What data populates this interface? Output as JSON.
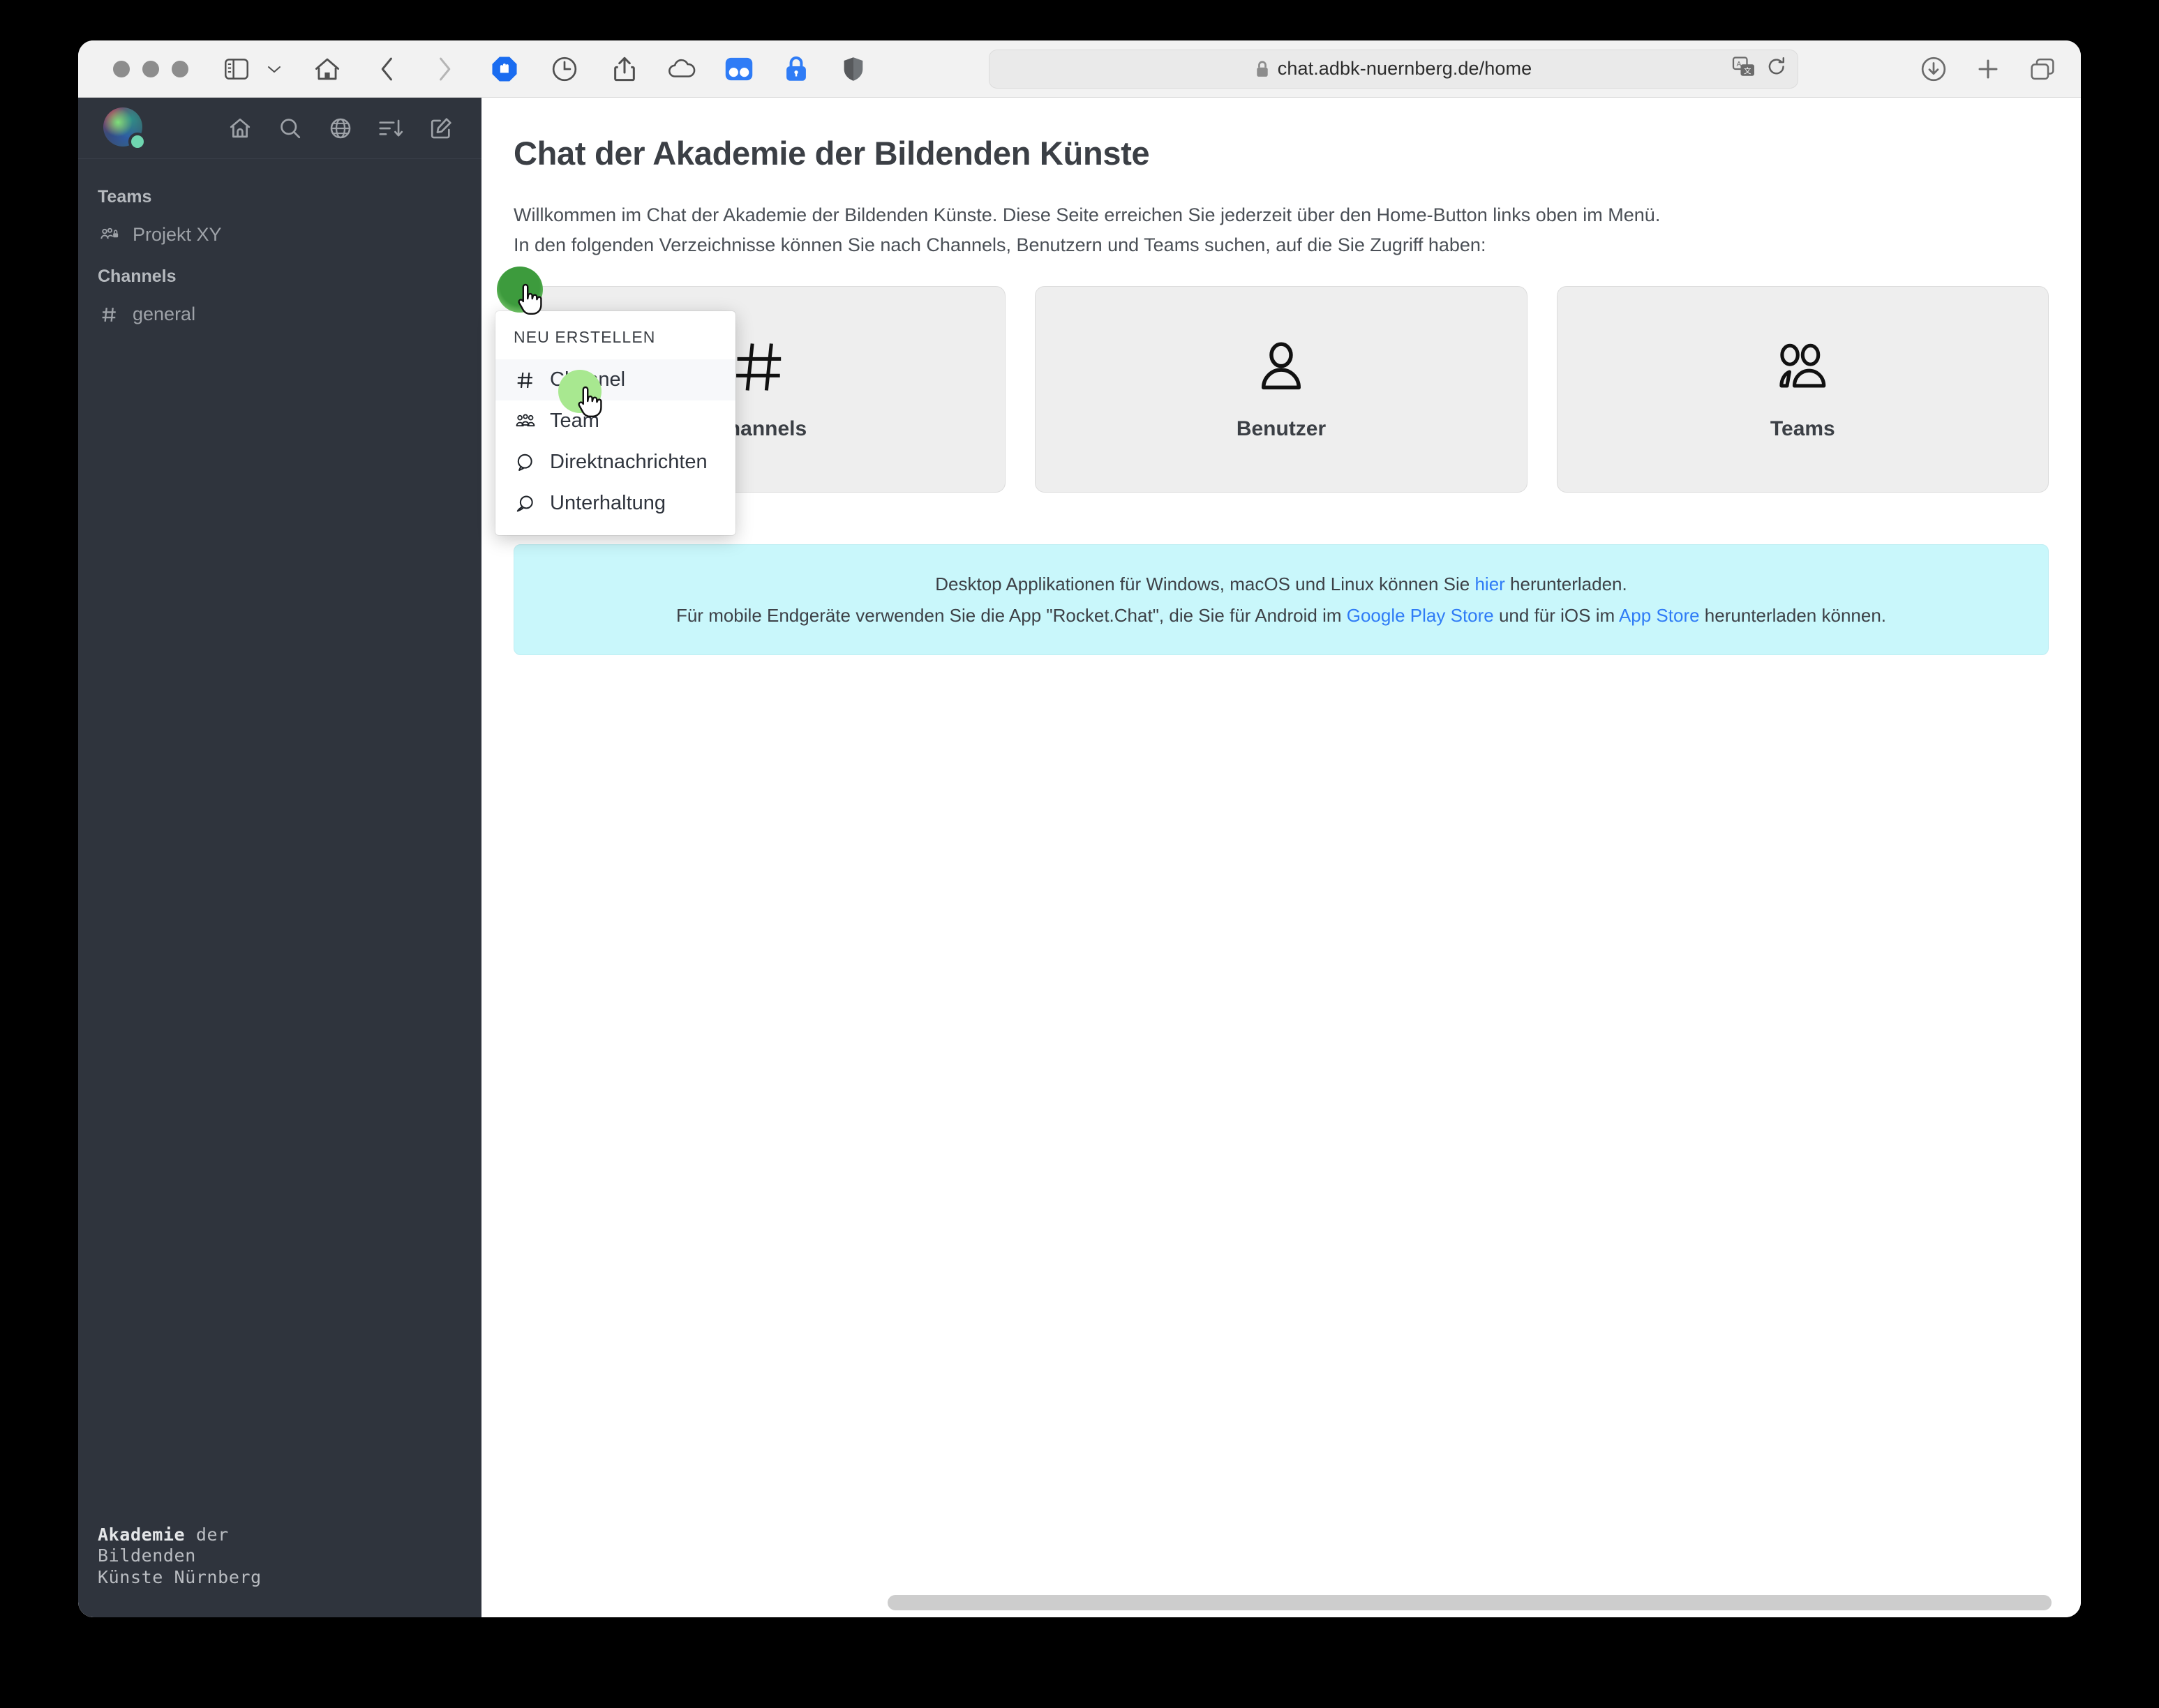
{
  "browser": {
    "url": "chat.adbk-nuernberg.de/home",
    "lock_icon": "lock-icon",
    "toolbar_left_icons": [
      "sidebar-toggle-icon",
      "chevron-down-icon",
      "home-icon",
      "back-arrow-icon",
      "forward-arrow-icon",
      "adblock-shield-icon",
      "history-clock-icon"
    ],
    "toolbar_mid_icons": [
      "share-icon",
      "icloud-icon",
      "dual-bookmarks-icon",
      "password-lock-icon",
      "privacy-shield-icon"
    ],
    "url_right_icons": [
      "translate-icon",
      "reload-icon"
    ],
    "toolbar_right_icons": [
      "downloads-icon",
      "new-tab-icon",
      "tab-overview-icon"
    ]
  },
  "sidebar": {
    "avatar": "user-avatar",
    "status": "online",
    "actions": [
      {
        "name": "home-icon",
        "label": "Home"
      },
      {
        "name": "search-icon",
        "label": "Suche"
      },
      {
        "name": "globe-directory-icon",
        "label": "Verzeichnis"
      },
      {
        "name": "sort-icon",
        "label": "Sortieren"
      },
      {
        "name": "create-new-pencil-icon",
        "label": "Neu erstellen"
      }
    ],
    "groups": [
      {
        "title": "Teams",
        "items": [
          {
            "icon": "team-lock-icon",
            "label": "Projekt XY"
          }
        ]
      },
      {
        "title": "Channels",
        "items": [
          {
            "icon": "hash-icon",
            "label": "general"
          }
        ]
      }
    ],
    "footer": {
      "line1_bold": "Akademie",
      "line1_rest": " der",
      "line2": "Bildenden",
      "line3": "Künste Nürnberg"
    }
  },
  "create_menu": {
    "title": "NEU ERSTELLEN",
    "items": [
      {
        "icon": "hash-icon",
        "label": "Channel",
        "active": true
      },
      {
        "icon": "team-icon",
        "label": "Team",
        "active": false
      },
      {
        "icon": "balloon-icon",
        "label": "Direktnachrichten",
        "active": false
      },
      {
        "icon": "discussion-icon",
        "label": "Unterhaltung",
        "active": false
      }
    ]
  },
  "main": {
    "title": "Chat der Akademie der Bildenden Künste",
    "intro_line_1": "Willkommen im Chat der Akademie der Bildenden Künste. Diese Seite erreichen Sie jederzeit über den Home-Button links oben im Menü.",
    "intro_line_2": "In den folgenden Verzeichnisse können Sie nach Channels, Benutzern und Teams suchen, auf die Sie Zugriff haben:",
    "cards": [
      {
        "icon": "hash-icon",
        "label": "Channels"
      },
      {
        "icon": "person-icon",
        "label": "Benutzer"
      },
      {
        "icon": "people-group-icon",
        "label": "Teams"
      }
    ],
    "banner": {
      "line1_a": "Desktop Applikationen für Windows, macOS und Linux können Sie ",
      "line1_link": "hier",
      "line1_b": " herunterladen.",
      "line2_a": "Für mobile Endgeräte verwenden Sie die App \"Rocket.Chat\", die Sie für Android im ",
      "line2_link1": "Google Play Store",
      "line2_b": " und für iOS im ",
      "line2_link2": "App Store",
      "line2_c": " herunterladen können."
    }
  },
  "colors": {
    "sidebar_bg": "#2f343d",
    "banner_bg": "#c9f7fb",
    "link": "#2f7cf6",
    "card_bg": "#eeeeee",
    "cursor_dark_green": "#3d9b3d",
    "cursor_light_green": "#a8e890"
  }
}
